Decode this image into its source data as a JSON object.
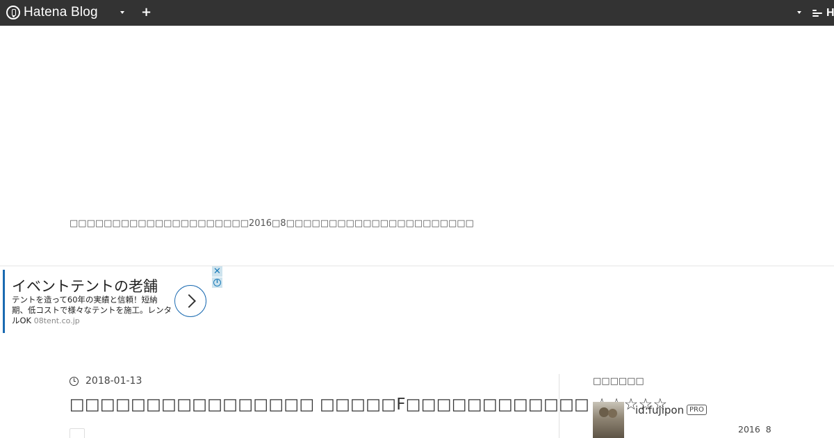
{
  "header": {
    "brand": "Hatena Blog",
    "right_brand": "H"
  },
  "blog": {
    "description": "□□□□□□□□□□□□□□□□□□□□□2016□8□□□□□□□□□□□□□□□□□□□□□□"
  },
  "ad": {
    "title": "イベントテントの老舗",
    "body": "テントを造って60年の実績と信頼！短納期、低コストで様々なテントを施工。レンタルOK",
    "domain": "08tent.co.jp",
    "close": "✕"
  },
  "entry": {
    "date": "2018-01-13",
    "title": "□□□□□□□□□□□□□□□□ □□□□□F□□□□□□□□□□□□ ☆☆☆☆☆"
  },
  "sidebar": {
    "heading": "□□□□□□",
    "profile_id": "id:fujipon",
    "badge": "PRO",
    "since": "2016  8"
  },
  "colors": {
    "topbar": "#333333",
    "ad_accent": "#1a6ab1"
  }
}
